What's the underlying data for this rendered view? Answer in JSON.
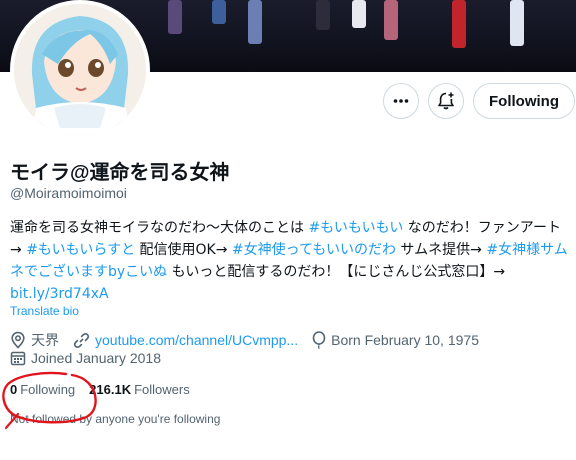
{
  "profile": {
    "display_name": "モイラ@運命を司る女神",
    "handle": "@Moiramoimoimoi",
    "bio": {
      "t1": "運命を司る女神モイラなのだわ～大体のことは ",
      "tag1": "#もいもいもい",
      "t2": " なのだわ！ファンアート→ ",
      "tag2": "#もいもいらすと",
      "t3": " 配信使用OK→ ",
      "tag3": "#女神使ってもいいのだわ",
      "t4": " サムネ提供→ ",
      "tag4": "#女神様サムネでございますbyこいぬ",
      "t5": " もいっと配信するのだわ！【にじさんじ公式窓口】→ ",
      "link": "bit.ly/3rd74xA"
    },
    "translate_label": "Translate bio",
    "location": "天界",
    "website": "youtube.com/channel/UCvmpp...",
    "birthday": "Born February 10, 1975",
    "joined": "Joined January 2018",
    "following_count": "0",
    "following_label": "Following",
    "followers_count": "216.1K",
    "followers_label": "Followers",
    "not_followed_note": "Not followed by anyone you're following"
  },
  "actions": {
    "more_icon": "more-horizontal-icon",
    "notify_icon": "bell-plus-icon",
    "follow_button_label": "Following"
  },
  "colors": {
    "accent": "#1d9bf0",
    "secondary_text": "#536471",
    "annotation": "#e0151c"
  }
}
